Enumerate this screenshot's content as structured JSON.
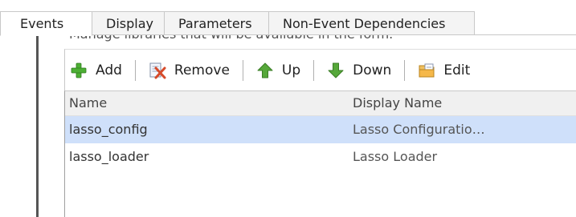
{
  "tabs": [
    {
      "label": "Events",
      "active": true
    },
    {
      "label": "Display",
      "active": false
    },
    {
      "label": "Parameters",
      "active": false
    },
    {
      "label": "Non-Event Dependencies",
      "active": false
    }
  ],
  "description": "Manage libraries that will be available in the form.",
  "toolbar": {
    "add_label": "Add",
    "remove_label": "Remove",
    "up_label": "Up",
    "down_label": "Down",
    "edit_label": "Edit"
  },
  "grid": {
    "columns": {
      "name": "Name",
      "display_name": "Display Name"
    },
    "rows": [
      {
        "name": "lasso_config",
        "display_name": "Lasso Configuratio…",
        "selected": true
      },
      {
        "name": "lasso_loader",
        "display_name": "Lasso Loader",
        "selected": false
      }
    ]
  },
  "colors": {
    "selected_row": "#cfe0fa",
    "add_icon": "#4caf34",
    "up_icon": "#56a83a",
    "down_icon": "#56a83a",
    "remove_icon": "#d64a2a",
    "edit_icon": "#e2a23a"
  },
  "icons": {
    "add": "plus-icon",
    "remove": "remove-icon",
    "up": "up-arrow-icon",
    "down": "down-arrow-icon",
    "edit": "edit-icon"
  }
}
